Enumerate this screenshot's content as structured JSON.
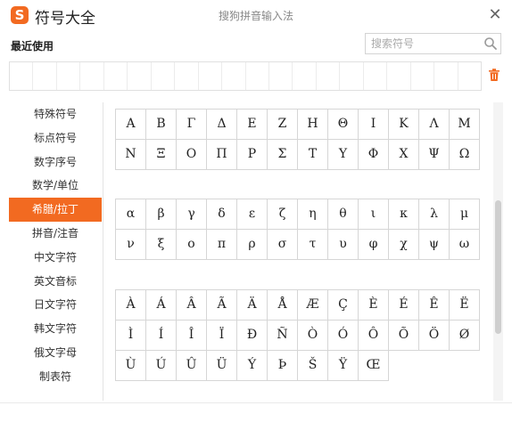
{
  "window": {
    "logo_letter": "S",
    "title": "符号大全",
    "ime_name": "搜狗拼音输入法",
    "close_glyph": "✕"
  },
  "recent": {
    "label": "最近使用"
  },
  "search": {
    "placeholder": "搜索符号",
    "value": ""
  },
  "sidebar": {
    "active_index": 4,
    "items": [
      {
        "label": "特殊符号"
      },
      {
        "label": "标点符号"
      },
      {
        "label": "数字序号"
      },
      {
        "label": "数学/单位"
      },
      {
        "label": "希腊/拉丁"
      },
      {
        "label": "拼音/注音"
      },
      {
        "label": "中文字符"
      },
      {
        "label": "英文音标"
      },
      {
        "label": "日文字符"
      },
      {
        "label": "韩文字符"
      },
      {
        "label": "俄文字母"
      },
      {
        "label": "制表符"
      }
    ]
  },
  "symbol_groups": [
    {
      "name": "greek-uppercase",
      "symbols": [
        "Α",
        "Β",
        "Γ",
        "Δ",
        "Ε",
        "Ζ",
        "Η",
        "Θ",
        "Ι",
        "Κ",
        "Λ",
        "Μ",
        "Ν",
        "Ξ",
        "Ο",
        "Π",
        "Ρ",
        "Σ",
        "Τ",
        "Υ",
        "Φ",
        "Χ",
        "Ψ",
        "Ω"
      ]
    },
    {
      "name": "greek-lowercase",
      "symbols": [
        "α",
        "β",
        "γ",
        "δ",
        "ε",
        "ζ",
        "η",
        "θ",
        "ι",
        "κ",
        "λ",
        "μ",
        "ν",
        "ξ",
        "ο",
        "π",
        "ρ",
        "σ",
        "τ",
        "υ",
        "φ",
        "χ",
        "ψ",
        "ω"
      ]
    },
    {
      "name": "latin-accented",
      "symbols": [
        "À",
        "Á",
        "Â",
        "Ã",
        "Ä",
        "Å",
        "Æ",
        "Ç",
        "È",
        "É",
        "Ê",
        "Ë",
        "Ì",
        "Í",
        "Î",
        "Ï",
        "Ð",
        "Ñ",
        "Ò",
        "Ó",
        "Ô",
        "Õ",
        "Ö",
        "Ø",
        "Ù",
        "Ú",
        "Û",
        "Ü",
        "Ý",
        "Þ",
        "Š",
        "Ÿ",
        "Œ"
      ]
    }
  ],
  "icons": {
    "search": "search-icon",
    "trash": "trash-icon",
    "close": "close-icon"
  },
  "colors": {
    "accent": "#f26a21"
  }
}
